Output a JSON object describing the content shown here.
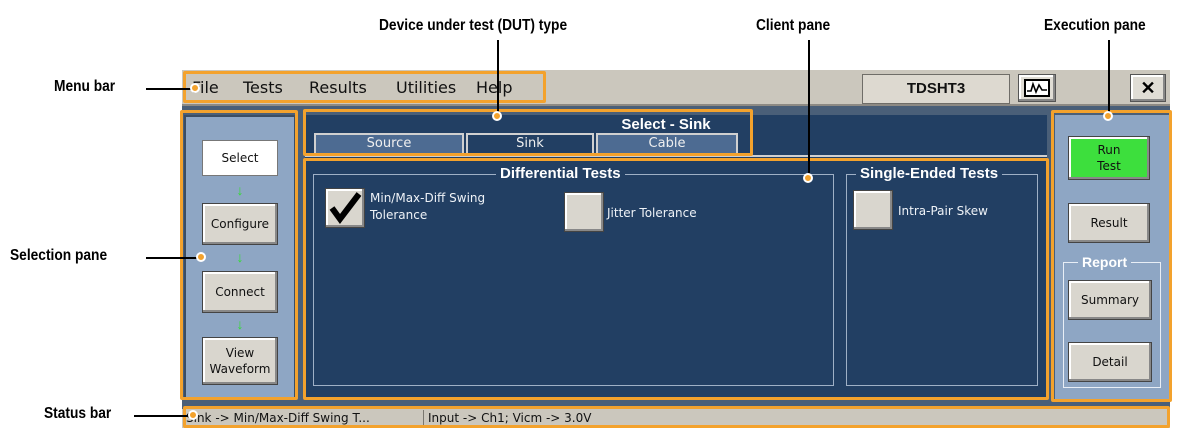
{
  "callouts": {
    "dut_type": "Device under test (DUT) type",
    "client_pane": "Client pane",
    "execution_pane": "Execution pane",
    "menu_bar": "Menu bar",
    "selection_pane": "Selection pane",
    "status_bar": "Status bar"
  },
  "menu": {
    "items": [
      "File",
      "Tests",
      "Results",
      "Utilities",
      "Help"
    ]
  },
  "window": {
    "title": "TDSHT3",
    "close_symbol": "✕"
  },
  "selection_pane": {
    "steps": [
      "Select",
      "Configure",
      "Connect",
      "View Waveform"
    ],
    "view_line1": "View",
    "view_line2": "Waveform",
    "arrow": "↓"
  },
  "client_pane": {
    "heading": "Select - Sink",
    "tabs": [
      "Source",
      "Sink",
      "Cable"
    ],
    "differential": {
      "title": "Differential Tests",
      "tests": [
        {
          "line1": "Min/Max-Diff Swing",
          "line2": "Tolerance",
          "checked": true
        },
        {
          "line1": "Jitter Tolerance",
          "line2": "",
          "checked": false
        }
      ]
    },
    "single_ended": {
      "title": "Single-Ended Tests",
      "tests": [
        {
          "line1": "Intra-Pair Skew",
          "checked": false
        }
      ]
    }
  },
  "execution_pane": {
    "run_line1": "Run",
    "run_line2": "Test",
    "result": "Result",
    "report_title": "Report",
    "summary": "Summary",
    "detail": "Detail"
  },
  "status_bar": {
    "left": "Sink -> Min/Max-Diff Swing T...",
    "right": "Input -> Ch1; Vicm -> 3.0V"
  },
  "colors": {
    "highlight": "#f3a22d",
    "client_bg": "#223f63",
    "pane_bg": "#8ea6c4",
    "run_green": "#3ddf3d"
  }
}
